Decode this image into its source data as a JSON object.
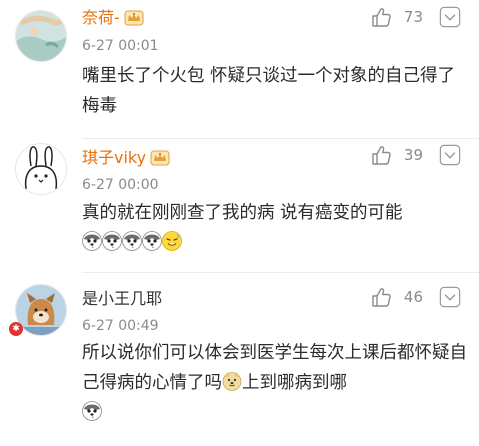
{
  "comments": [
    {
      "username": "奈荷-",
      "name_color": "#e8710a",
      "time": "6-27 00:01",
      "likes": "73",
      "body": "嘴里长了个火包  怀疑只谈过一个对象的自己得了梅毒",
      "icons": [
        "crown-badge-icon",
        "thumbs-up-icon",
        "chevron-down-icon"
      ]
    },
    {
      "username": "琪子viky",
      "name_color": "#e8710a",
      "time": "6-27 00:00",
      "likes": "39",
      "body": "真的就在刚刚查了我的病 说有癌变的可能",
      "icons": [
        "crown-badge-icon",
        "thumbs-up-icon",
        "chevron-down-icon",
        "husky-emoji-icon",
        "sweat-smile-emoji-icon"
      ]
    },
    {
      "username": "是小王几耶",
      "name_color": "#333333",
      "time": "6-27 00:49",
      "likes": "46",
      "body_part1": "所以说你们可以体会到医学生每次上课后都怀疑自己得病的心情了吗",
      "body_part2": "上到哪病到哪",
      "icons": [
        "thumbs-up-icon",
        "chevron-down-icon",
        "doge-emoji-icon",
        "husky-emoji-icon"
      ]
    }
  ]
}
